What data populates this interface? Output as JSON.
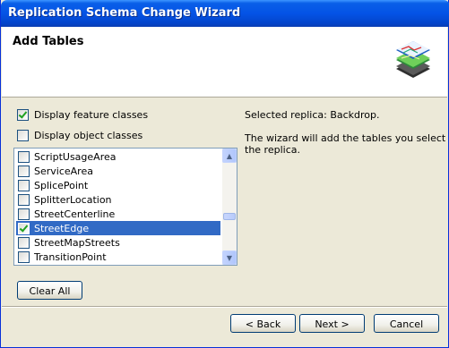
{
  "window": {
    "title": "Replication Schema Change Wizard"
  },
  "header": {
    "title": "Add Tables",
    "icon": "layers-map-icon"
  },
  "options": {
    "display_feature_classes": {
      "label": "Display feature classes",
      "checked": true
    },
    "display_object_classes": {
      "label": "Display object classes",
      "checked": false
    }
  },
  "list": {
    "items": [
      {
        "label": "ScriptUsageArea",
        "checked": false,
        "selected": false
      },
      {
        "label": "ServiceArea",
        "checked": false,
        "selected": false
      },
      {
        "label": "SplicePoint",
        "checked": false,
        "selected": false
      },
      {
        "label": "SplitterLocation",
        "checked": false,
        "selected": false
      },
      {
        "label": "StreetCenterline",
        "checked": false,
        "selected": false
      },
      {
        "label": "StreetEdge",
        "checked": true,
        "selected": true
      },
      {
        "label": "StreetMapStreets",
        "checked": false,
        "selected": false
      },
      {
        "label": "TransitionPoint",
        "checked": false,
        "selected": false
      }
    ]
  },
  "info": {
    "selected_replica": "Selected replica: Backdrop.",
    "description_line1": "The wizard will add the tables you select to",
    "description_line2": "the replica."
  },
  "buttons": {
    "clear_all": "Clear All",
    "back": "< Back",
    "next": "Next >",
    "cancel": "Cancel"
  }
}
